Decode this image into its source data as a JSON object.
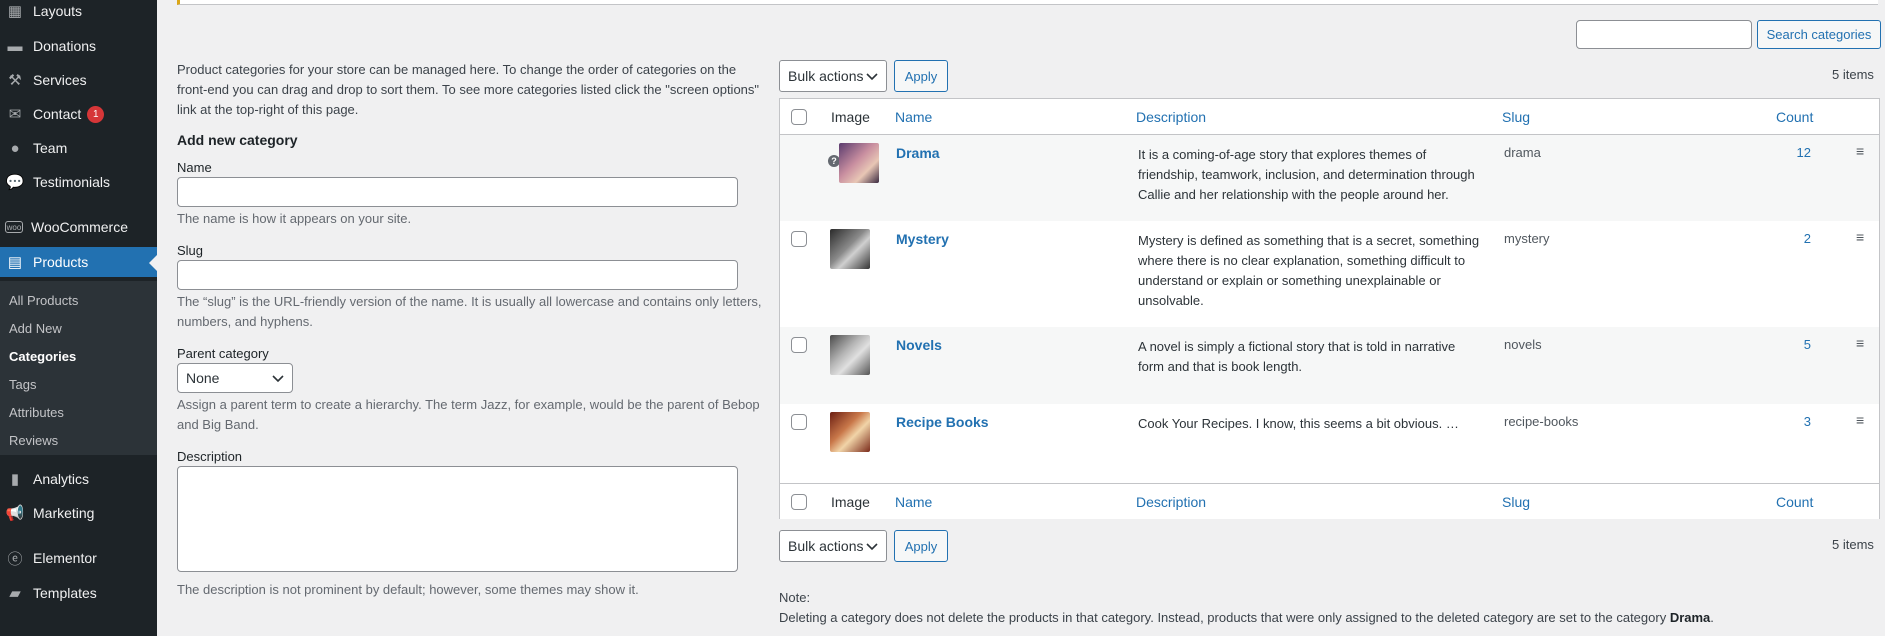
{
  "sidebar": {
    "items": [
      {
        "label": "Layouts",
        "icon": "layout-icon"
      },
      {
        "label": "Donations",
        "icon": "donations-icon"
      },
      {
        "label": "Services",
        "icon": "services-icon"
      },
      {
        "label": "Contact",
        "icon": "mail-icon",
        "badge": "1"
      },
      {
        "label": "Team",
        "icon": "person-icon"
      },
      {
        "label": "Testimonials",
        "icon": "speech-bubble-icon"
      },
      {
        "label": "WooCommerce",
        "icon": "woocommerce-icon"
      },
      {
        "label": "Products",
        "icon": "archive-icon",
        "active": true
      },
      {
        "label": "Analytics",
        "icon": "bar-chart-icon"
      },
      {
        "label": "Marketing",
        "icon": "megaphone-icon"
      },
      {
        "label": "Elementor",
        "icon": "elementor-icon"
      },
      {
        "label": "Templates",
        "icon": "folder-icon"
      }
    ],
    "submenu": [
      "All Products",
      "Add New",
      "Categories",
      "Tags",
      "Attributes",
      "Reviews"
    ],
    "submenu_current": "Categories",
    "accent": "#2271b1"
  },
  "search": {
    "button_label": "Search categories",
    "value": ""
  },
  "form": {
    "intro": "Product categories for your store can be managed here. To change the order of categories on the front-end you can drag and drop to sort them. To see more categories listed click the \"screen options\" link at the top-right of this page.",
    "heading": "Add new category",
    "name_label": "Name",
    "name_desc": "The name is how it appears on your site.",
    "slug_label": "Slug",
    "slug_desc": "The “slug” is the URL-friendly version of the name. It is usually all lowercase and contains only letters, numbers, and hyphens.",
    "parent_label": "Parent category",
    "parent_value": "None",
    "parent_desc": "Assign a parent term to create a hierarchy. The term Jazz, for example, would be the parent of Bebop and Big Band.",
    "description_label": "Description",
    "description_desc": "The description is not prominent by default; however, some themes may show it."
  },
  "table": {
    "bulk_label": "Bulk actions",
    "apply_label": "Apply",
    "items_count": "5 items",
    "columns": {
      "image": "Image",
      "name": "Name",
      "description": "Description",
      "slug": "Slug",
      "count": "Count"
    },
    "rows": [
      {
        "name": "Drama",
        "description": "It is a coming-of-age story that explores themes of friendship, teamwork, inclusion, and determination through Callie and her relationship with the people around her.",
        "slug": "drama",
        "count": "12",
        "help": "?"
      },
      {
        "name": "Mystery",
        "description": "Mystery is defined as something that is a secret, something where there is no clear explanation, something difficult to understand or explain or something unexplainable or unsolvable.",
        "slug": "mystery",
        "count": "2"
      },
      {
        "name": "Novels",
        "description": "A novel is simply a fictional story that is told in narrative form and that is book length.",
        "slug": "novels",
        "count": "5"
      },
      {
        "name": "Recipe Books",
        "description": "Cook Your Recipes. I know, this seems a bit obvious. …",
        "slug": "recipe-books",
        "count": "3"
      }
    ]
  },
  "note": {
    "title": "Note:",
    "text": "Deleting a category does not delete the products in that category. Instead, products that were only assigned to the deleted category are set to the category ",
    "default_category": "Drama",
    "end": "."
  }
}
